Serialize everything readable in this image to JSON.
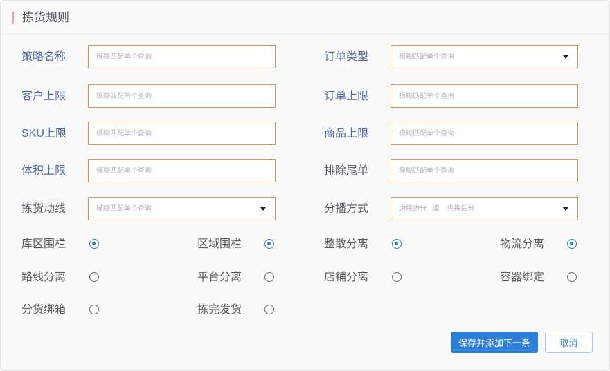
{
  "header": {
    "title": "拣货规则"
  },
  "placeholder": "模糊匹配单个查询",
  "fields": {
    "strategy_name": {
      "label": "策略名称"
    },
    "order_type": {
      "label": "订单类型"
    },
    "customer_limit": {
      "label": "客户上限"
    },
    "order_limit": {
      "label": "订单上限"
    },
    "sku_limit": {
      "label": "SKU上限"
    },
    "goods_limit": {
      "label": "商品上限"
    },
    "volume_limit": {
      "label": "体积上限"
    },
    "exclude_tail": {
      "label": "排除尾单"
    },
    "picking_route": {
      "label": "拣货动线"
    },
    "sorting_method": {
      "label": "分播方式",
      "value": "边拣边分   或    先拣后分"
    }
  },
  "toggles": {
    "warehouse_fence": {
      "label": "库区围栏",
      "checked": true
    },
    "region_fence": {
      "label": "区域围栏",
      "checked": true
    },
    "bulk_split": {
      "label": "整散分离",
      "checked": true
    },
    "logistics_split": {
      "label": "物流分离",
      "checked": true
    },
    "route_split": {
      "label": "路线分离",
      "checked": false
    },
    "platform_split": {
      "label": "平台分离",
      "checked": false
    },
    "store_split": {
      "label": "店铺分离",
      "checked": false
    },
    "container_bind": {
      "label": "容器绑定",
      "checked": false
    },
    "sort_bind_box": {
      "label": "分货绑箱",
      "checked": false
    },
    "pick_then_ship": {
      "label": "拣完发货",
      "checked": false
    }
  },
  "actions": {
    "save_next": "保存并添加下一条",
    "cancel": "取消"
  },
  "colors": {
    "accent": "#2f7fd9",
    "label_blue": "#4f6ba3",
    "field_border": "#d9914e",
    "title_bar": "#f4a0a8"
  }
}
